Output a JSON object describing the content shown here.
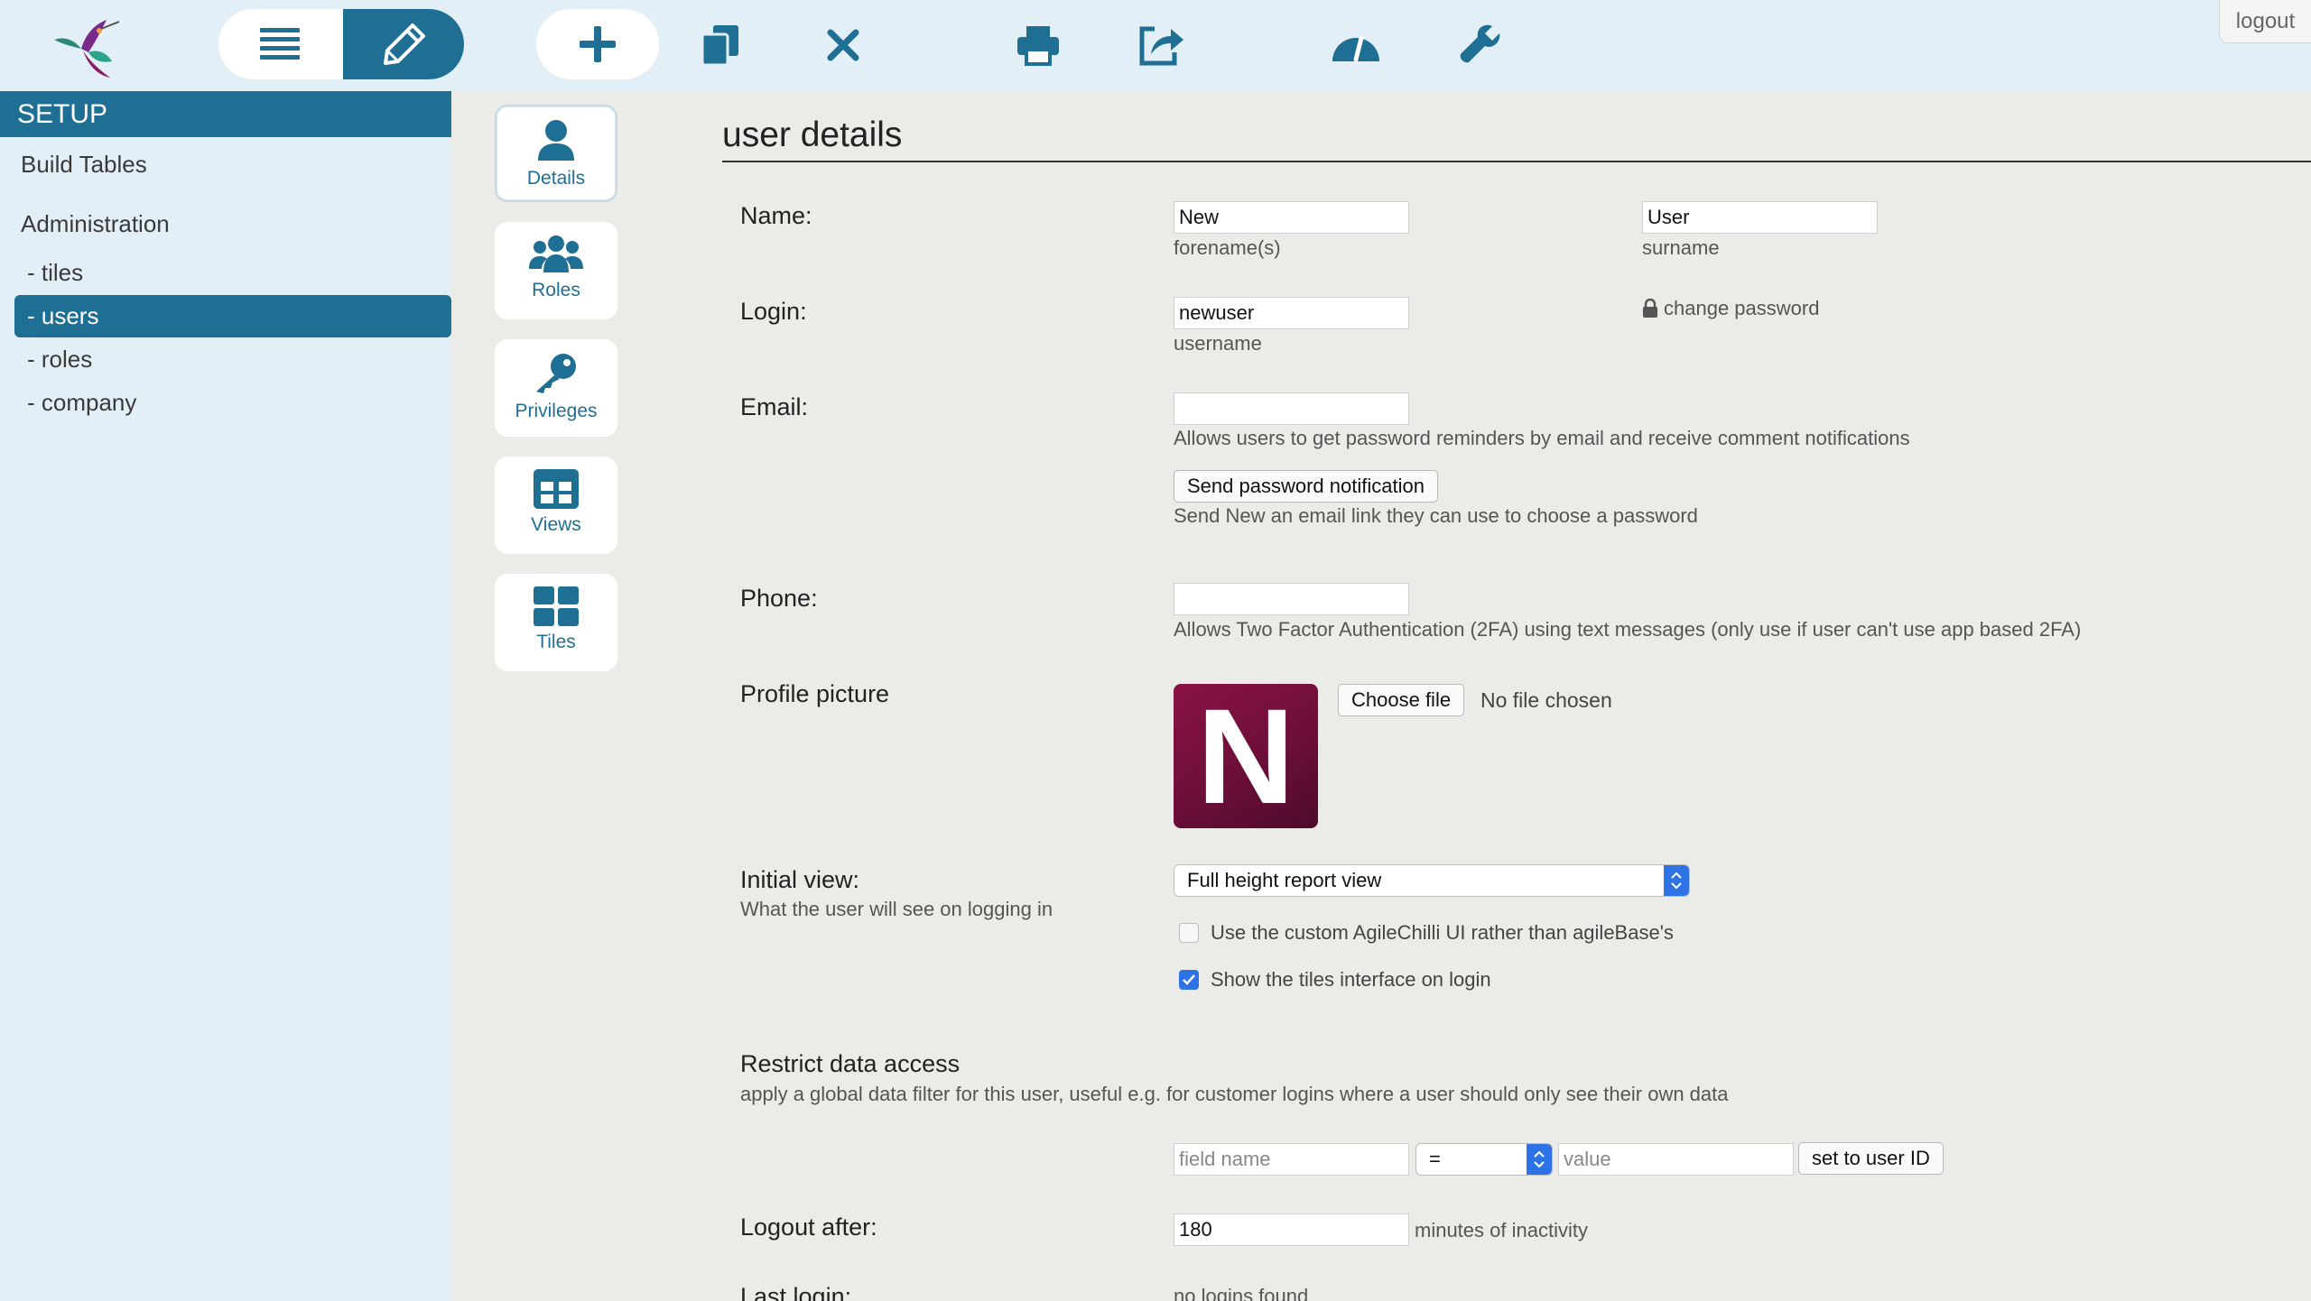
{
  "toolbar": {
    "logout_label": "logout",
    "icons": [
      "app-logo",
      "list-icon",
      "pencil-icon",
      "plus-icon",
      "copy-icon",
      "close-icon",
      "print-icon",
      "share-icon",
      "gauge-icon",
      "wrench-icon"
    ],
    "accent": "#1f6f95"
  },
  "sidebar": {
    "header": "SETUP",
    "build_tables": "Build Tables",
    "administration": "Administration",
    "items": [
      {
        "label": "- tiles",
        "active": false
      },
      {
        "label": "- users",
        "active": true
      },
      {
        "label": "- roles",
        "active": false
      },
      {
        "label": "- company",
        "active": false
      }
    ]
  },
  "tabs": [
    {
      "label": "Details",
      "icon": "user-icon",
      "active": true
    },
    {
      "label": "Roles",
      "icon": "users-icon",
      "active": false
    },
    {
      "label": "Privileges",
      "icon": "key-icon",
      "active": false
    },
    {
      "label": "Views",
      "icon": "table-icon",
      "active": false
    },
    {
      "label": "Tiles",
      "icon": "grid-icon",
      "active": false
    }
  ],
  "form": {
    "title": "user details",
    "name": {
      "label": "Name:",
      "forename": "New",
      "forename_help": "forename(s)",
      "surname": "User",
      "surname_help": "surname"
    },
    "login": {
      "label": "Login:",
      "username": "newuser",
      "username_help": "username",
      "change_password": "change password"
    },
    "email": {
      "label": "Email:",
      "value": "",
      "help": "Allows users to get password reminders by email and receive comment notifications",
      "button": "Send password notification",
      "button_help": "Send New an email link they can use to choose a password"
    },
    "phone": {
      "label": "Phone:",
      "value": "",
      "help": "Allows Two Factor Authentication (2FA) using text messages (only use if user can't use app based 2FA)"
    },
    "profile": {
      "label": "Profile picture",
      "avatar_letter": "N",
      "choose_file": "Choose file",
      "no_file": "No file chosen"
    },
    "initial_view": {
      "label": "Initial view:",
      "help": "What the user will see on logging in",
      "selected": "Full height report view",
      "option_custom_ui": {
        "label": "Use the custom AgileChilli UI rather than agileBase's",
        "checked": false
      },
      "option_tiles": {
        "label": "Show the tiles interface on login",
        "checked": true
      }
    },
    "restrict": {
      "label": "Restrict data access",
      "help": "apply a global data filter for this user, useful e.g. for customer logins where a user should only see their own data",
      "field_placeholder": "field name",
      "operator": "=",
      "value_placeholder": "value",
      "button": "set to user ID"
    },
    "logout_after": {
      "label": "Logout after:",
      "value": "180",
      "suffix": "minutes of inactivity"
    },
    "last_login": {
      "label": "Last login:",
      "value": "no logins found"
    }
  }
}
